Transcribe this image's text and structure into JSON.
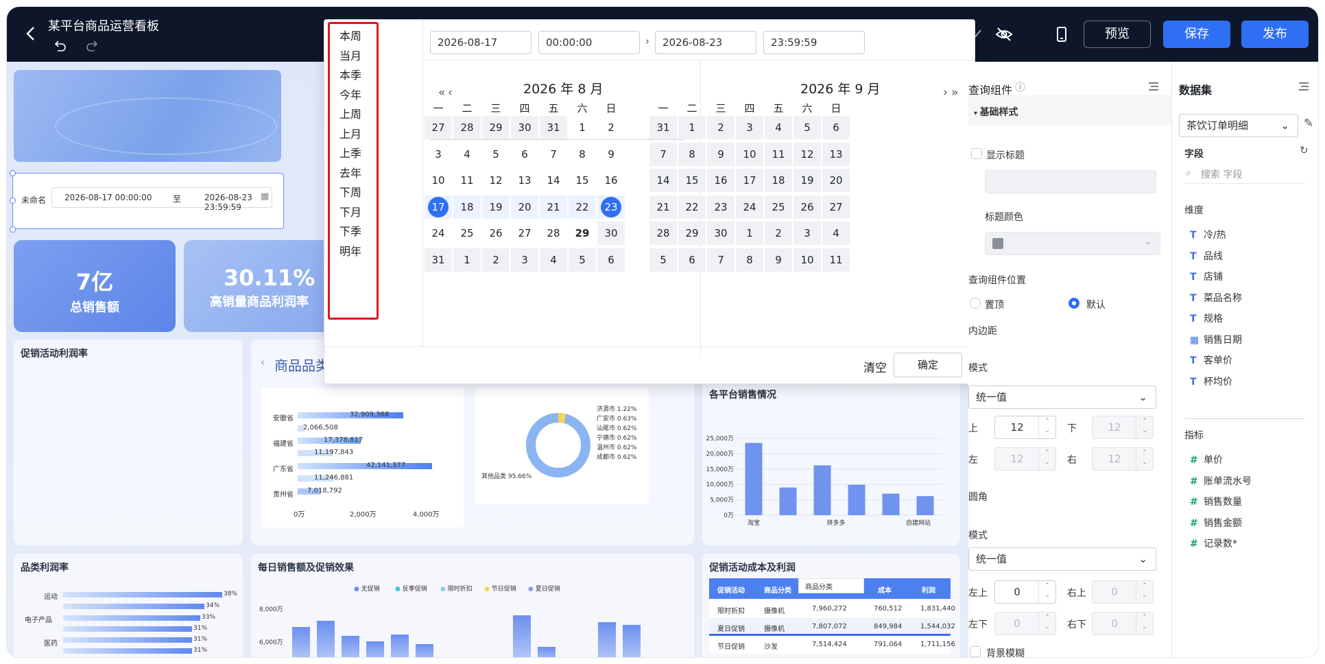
{
  "topbar": {
    "title": "某平台商品运营看板",
    "preview": "预览",
    "save": "保存",
    "publish": "发布"
  },
  "query": {
    "label": "未命名",
    "start": "2026-08-17 00:00:00",
    "to": "至",
    "end": "2026-08-23 23:59:59"
  },
  "kpis": [
    {
      "value": "7亿",
      "label": "总销售额"
    },
    {
      "value": "30.11%",
      "label": "高销量商品利润率"
    }
  ],
  "cards": {
    "promo_rate": "促销活动利润率",
    "category_title": "商品品类",
    "category_rate": "品类利润率",
    "daily": "每日销售额及促销效果",
    "platform": "各平台销售情况",
    "promo_cost": "促销活动成本及利润"
  },
  "province_chart": {
    "labels": [
      "安徽省",
      "福建省",
      "广东省",
      "贵州省"
    ],
    "values": [
      "32,909,368",
      "2,066,508",
      "17,378,817",
      "11,197,843",
      "42,141,377",
      "11,246,881",
      "7,018,792"
    ],
    "ticks": [
      "0万",
      "2,000万",
      "4,000万"
    ]
  },
  "donut": {
    "labels": [
      "济源市 1.22%",
      "广安市 0.63%",
      "汕尾市 0.62%",
      "宁德市 0.62%",
      "温州市 0.62%",
      "成都市 0.62%"
    ],
    "other": "其他品类 95.66%"
  },
  "platform_chart": {
    "yticks": [
      "25,000万",
      "20,000万",
      "15,000万",
      "10,000万",
      "5,000万",
      "0万"
    ],
    "xlabels": [
      "淘宝",
      "拼多多",
      "自建网站"
    ]
  },
  "chart_data": {
    "type": "bar",
    "title": "各平台销售情况",
    "categories": [
      "淘宝",
      "",
      "拼多多",
      "",
      "",
      "",
      "自建网站"
    ],
    "values": [
      23500,
      9000,
      16200,
      9900,
      7000,
      6200
    ],
    "ylim": [
      0,
      25000
    ]
  },
  "catrate": {
    "labels": [
      "运动",
      "电子产品",
      "医药"
    ],
    "pcts": [
      "38%",
      "34%",
      "33%",
      "31%",
      "31%",
      "31%"
    ]
  },
  "daily_chart": {
    "legend": [
      "无促销",
      "反季促销",
      "限时折扣",
      "节日促销",
      "夏日促销"
    ],
    "yticks": [
      "8,000万",
      "6,000万"
    ]
  },
  "promo_table": {
    "headers": [
      "促销活动",
      "商品分类",
      "商品分类",
      "成本",
      "利润"
    ],
    "rows": [
      [
        "限时折扣",
        "摄像机",
        "7,960,272",
        "760,512",
        "1,831,440"
      ],
      [
        "夏日促销",
        "摄像机",
        "7,807,072",
        "849,984",
        "1,544,032"
      ],
      [
        "节日促销",
        "沙发",
        "7,514,424",
        "791,064",
        "1,711,156"
      ]
    ]
  },
  "picker": {
    "presets": [
      "本周",
      "当月",
      "本季",
      "今年",
      "上周",
      "上月",
      "上季",
      "去年",
      "下周",
      "下月",
      "下季",
      "明年"
    ],
    "start_date": "2026-08-17",
    "start_time": "00:00:00",
    "end_date": "2026-08-23",
    "end_time": "23:59:59",
    "left_title": "2026 年 8 月",
    "right_title": "2026 年 9 月",
    "weekdays": [
      "一",
      "二",
      "三",
      "四",
      "五",
      "六",
      "日"
    ],
    "left_days": [
      "27",
      "28",
      "29",
      "30",
      "31",
      "1",
      "2",
      "3",
      "4",
      "5",
      "6",
      "7",
      "8",
      "9",
      "10",
      "11",
      "12",
      "13",
      "14",
      "15",
      "16",
      "17",
      "18",
      "19",
      "20",
      "21",
      "22",
      "23",
      "24",
      "25",
      "26",
      "27",
      "28",
      "29",
      "30",
      "31",
      "1",
      "2",
      "3",
      "4",
      "5",
      "6"
    ],
    "right_days": [
      "31",
      "1",
      "2",
      "3",
      "4",
      "5",
      "6",
      "7",
      "8",
      "9",
      "10",
      "11",
      "12",
      "13",
      "14",
      "15",
      "16",
      "17",
      "18",
      "19",
      "20",
      "21",
      "22",
      "23",
      "24",
      "25",
      "26",
      "27",
      "28",
      "29",
      "30",
      "1",
      "2",
      "3",
      "4",
      "5",
      "6",
      "7",
      "8",
      "9",
      "10",
      "11"
    ],
    "clear": "清空",
    "confirm": "确定"
  },
  "props": {
    "title": "查询组件",
    "basic": "基础样式",
    "show_title": "显示标题",
    "title_color": "标题颜色",
    "position": "查询组件位置",
    "top": "置顶",
    "default": "默认",
    "padding": "内边距",
    "mode": "模式",
    "uniform": "统一值",
    "up": "上",
    "down": "下",
    "left": "左",
    "right": "右",
    "pad_vals": [
      "12",
      "12",
      "12",
      "12"
    ],
    "radius": "圆角",
    "mode2": "模式",
    "uniform2": "统一值",
    "tl": "左上",
    "tr": "右上",
    "bl": "左下",
    "br": "右下",
    "rad_vals": [
      "0",
      "0",
      "0",
      "0"
    ],
    "blur": "背景模糊"
  },
  "dataset": {
    "title": "数据集",
    "selected": "茶饮订单明细",
    "fields": "字段",
    "search": "搜索 字段",
    "dims_title": "维度",
    "dims": [
      "冷/热",
      "品线",
      "店铺",
      "菜品名称",
      "规格",
      "销售日期",
      "客单价",
      "杯均价"
    ],
    "measures_title": "指标",
    "measures": [
      "单价",
      "账单流水号",
      "销售数量",
      "销售金额",
      "记录数*"
    ]
  }
}
